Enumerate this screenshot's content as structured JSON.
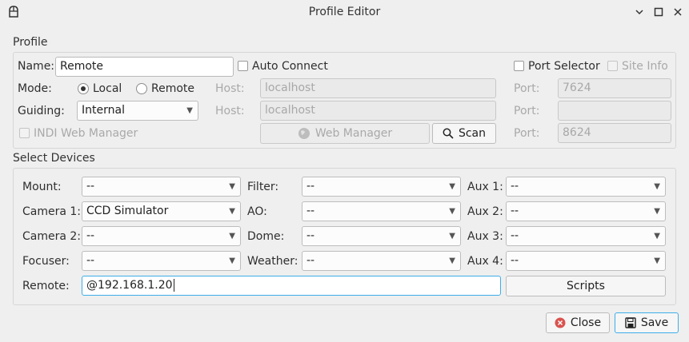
{
  "window": {
    "title": "Profile Editor"
  },
  "profile": {
    "section_label": "Profile",
    "name_label": "Name:",
    "name_value": "Remote",
    "auto_connect_label": "Auto Connect",
    "port_selector_label": "Port Selector",
    "site_info_label": "Site Info",
    "mode_label": "Mode:",
    "mode_local": "Local",
    "mode_remote": "Remote",
    "mode_selected": "Local",
    "host_label": "Host:",
    "host1_value": "localhost",
    "port_label": "Port:",
    "port1_value": "7624",
    "guiding_label": "Guiding:",
    "guiding_value": "Internal",
    "host2_value": "localhost",
    "port2_value": "",
    "indi_web_manager_label": "INDI Web Manager",
    "web_manager_button": "Web Manager",
    "scan_button": "Scan",
    "port3_value": "8624"
  },
  "devices": {
    "section_label": "Select Devices",
    "mount": {
      "label": "Mount:",
      "value": "--"
    },
    "camera1": {
      "label": "Camera 1:",
      "value": "CCD Simulator"
    },
    "camera2": {
      "label": "Camera 2:",
      "value": "--"
    },
    "focuser": {
      "label": "Focuser:",
      "value": "--"
    },
    "filter": {
      "label": "Filter:",
      "value": "--"
    },
    "ao": {
      "label": "AO:",
      "value": "--"
    },
    "dome": {
      "label": "Dome:",
      "value": "--"
    },
    "weather": {
      "label": "Weather:",
      "value": "--"
    },
    "aux1": {
      "label": "Aux 1:",
      "value": "--"
    },
    "aux2": {
      "label": "Aux 2:",
      "value": "--"
    },
    "aux3": {
      "label": "Aux 3:",
      "value": "--"
    },
    "aux4": {
      "label": "Aux 4:",
      "value": "--"
    },
    "remote_label": "Remote:",
    "remote_value": "@192.168.1.20",
    "scripts_button": "Scripts"
  },
  "footer": {
    "close_button": "Close",
    "save_button": "Save"
  },
  "colors": {
    "focus": "#3daee9",
    "close_icon": "#d9534f"
  }
}
